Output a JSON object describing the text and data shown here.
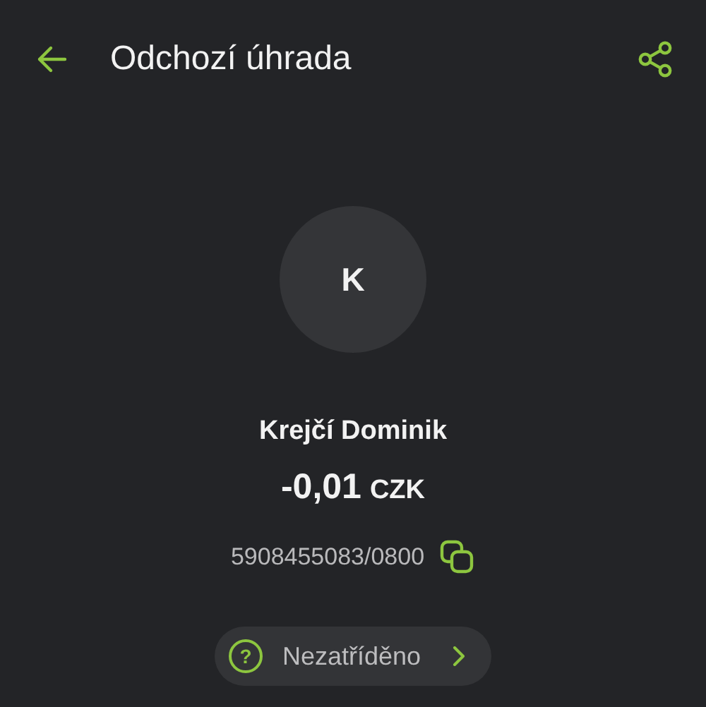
{
  "header": {
    "title": "Odchozí úhrada"
  },
  "counterparty": {
    "initial": "K",
    "name": "Krejčí Dominik"
  },
  "amount": {
    "value": "-0,01",
    "currency": "CZK"
  },
  "account": {
    "number": "5908455083/0800"
  },
  "category": {
    "icon": "?",
    "label": "Nezatříděno"
  }
}
